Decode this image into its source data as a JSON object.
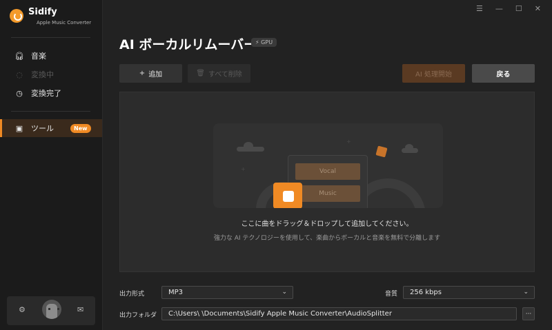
{
  "app": {
    "name": "Sidify",
    "subtitle": "Apple Music Converter"
  },
  "sidebar": {
    "items": [
      {
        "label": "音楽",
        "icon": "headphones-icon",
        "state": "normal"
      },
      {
        "label": "変換中",
        "icon": "converting-icon",
        "state": "disabled"
      },
      {
        "label": "変換完了",
        "icon": "clock-icon",
        "state": "normal"
      },
      {
        "label": "ツール",
        "icon": "toolbox-icon",
        "state": "active",
        "badge": "New"
      }
    ],
    "bottom": {
      "settings_icon": "gear-icon",
      "avatar": "user-avatar",
      "mail_icon": "mail-icon"
    }
  },
  "window_controls": {
    "menu": "☰",
    "minimize": "—",
    "maximize": "☐",
    "close": "✕"
  },
  "page": {
    "title": "AI ボーカルリムーバー",
    "gpu_badge": "GPU"
  },
  "toolbar": {
    "add_label": "追加",
    "delete_label": "すべて削除",
    "ai_start_label": "AI 処理開始",
    "back_label": "戻る"
  },
  "dropzone": {
    "vocal_label": "Vocal",
    "music_label": "Music",
    "main_text": "ここに曲をドラッグ＆ドロップして追加してください。",
    "sub_text": "強力な AI テクノロジーを使用して、楽曲からボーカルと音楽を無料で分離します"
  },
  "settings": {
    "format_label": "出力形式",
    "format_value": "MP3",
    "quality_label": "音質",
    "quality_value": "256 kbps",
    "folder_label": "出力フォルダ",
    "folder_value": "C:\\Users\\          \\Documents\\Sidify Apple Music Converter\\AudioSplitter",
    "browse_label": "···"
  },
  "colors": {
    "accent": "#f08a24",
    "background": "#222222",
    "sidebar": "#1b1b1b"
  }
}
